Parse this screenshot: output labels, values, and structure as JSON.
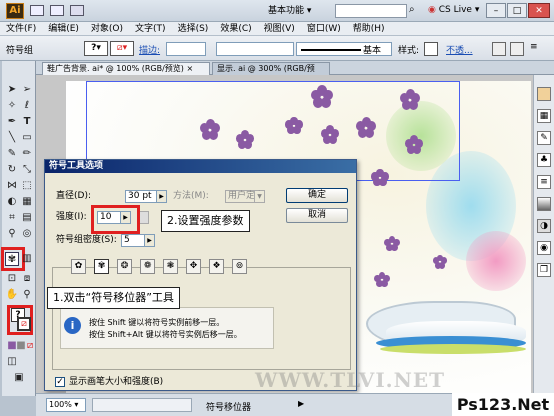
{
  "titlebar": {
    "logo": "Ai",
    "workspace": "基本功能",
    "cs_live": "CS Live"
  },
  "menubar": [
    "文件(F)",
    "编辑(E)",
    "对象(O)",
    "文字(T)",
    "选择(S)",
    "效果(C)",
    "视图(V)",
    "窗口(W)",
    "帮助(H)"
  ],
  "ctrlbar": {
    "group_label": "符号组",
    "stroke_label": "描边:",
    "basic_label": "基本",
    "style_label": "样式:",
    "opacity_label": "不透..."
  },
  "tabs": [
    "鞋广告背景. ai* @ 100% (RGB/预览)",
    "显示. ai @ 300% (RGB/预览)"
  ],
  "dialog": {
    "title": "符号工具选项",
    "diameter_label": "直径(D):",
    "diameter_value": "30 pt",
    "method_label": "方法(M):",
    "method_value": "用户定义",
    "intensity_label": "强度(I):",
    "intensity_value": "10",
    "density_label": "符号组密度(S):",
    "density_value": "5",
    "ok": "确定",
    "cancel": "取消",
    "info_line1": "按住 Shift 键以将符号实例前移一层。",
    "info_line2": "按住 Shift+Alt 键以将符号实例后移一层。",
    "show_brush_label": "显示画笔大小和强度(B)",
    "show_brush_checked": true
  },
  "callouts": {
    "step1": "1.双击“符号移位器”工具",
    "step2": "2.设置强度参数"
  },
  "status": {
    "zoom": "100%",
    "tool": "符号移位器"
  },
  "watermark": "WWW.TLVI.NET",
  "logo": "Ps123.Net"
}
